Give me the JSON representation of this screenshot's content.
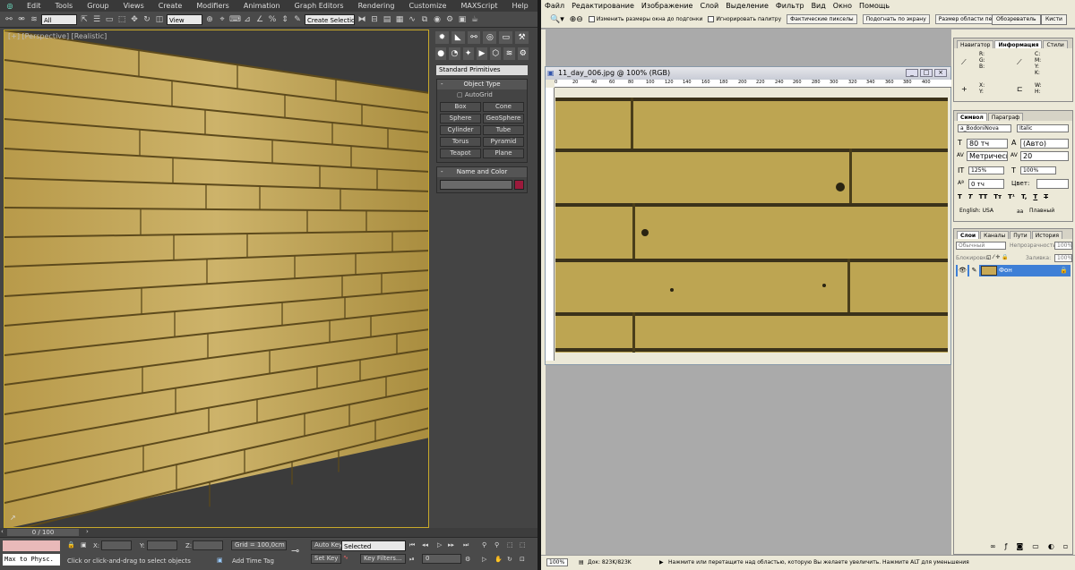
{
  "max": {
    "menu": [
      "Edit",
      "Tools",
      "Group",
      "Views",
      "Create",
      "Modifiers",
      "Animation",
      "Graph Editors",
      "Rendering",
      "Customize",
      "MAXScript",
      "Help"
    ],
    "toolbar": {
      "filter": "All",
      "ref_coord": "View",
      "selection_set": "Create Selection Se"
    },
    "viewport_label": "[+] [Perspective] [Realistic]",
    "command_panel": {
      "category": "Standard Primitives",
      "object_type_title": "Object Type",
      "autogrid": "AutoGrid",
      "primitives": [
        "Box",
        "Cone",
        "Sphere",
        "GeoSphere",
        "Cylinder",
        "Tube",
        "Torus",
        "Pyramid",
        "Teapot",
        "Plane"
      ],
      "name_color_title": "Name and Color",
      "object_color": "#9c1a3c"
    },
    "time_slider": "0 / 100",
    "status": {
      "listener_text": "Max to Physc.",
      "prompt": "Click or click-and-drag to select objects",
      "x_label": "X:",
      "y_label": "Y:",
      "z_label": "Z:",
      "grid": "Grid = 100,0cm",
      "add_time_tag": "Add Time Tag",
      "auto_key": "Auto Key",
      "set_key": "Set Key",
      "selected": "Selected",
      "key_filters": "Key Filters...",
      "frame": "0"
    }
  },
  "ps": {
    "menu": [
      "Файл",
      "Редактирование",
      "Изображение",
      "Слой",
      "Выделение",
      "Фильтр",
      "Вид",
      "Окно",
      "Помощь"
    ],
    "options": {
      "resize_windows": "Изменить размеры окна до подгонки",
      "ignore_palettes": "Игнорировать палитру",
      "actual_pixels": "Фактические пикселы",
      "fit_screen": "Подогнать по экрану",
      "print_size": "Размер области печати"
    },
    "workspace": {
      "browser": "Обозреватель",
      "brushes": "Кисти"
    },
    "document": {
      "title": "11_day_006.jpg @ 100% (RGB)",
      "ruler": [
        "0",
        "20",
        "40",
        "60",
        "80",
        "100",
        "120",
        "140",
        "160",
        "180",
        "200",
        "220",
        "240",
        "260",
        "280",
        "300",
        "320",
        "340",
        "360",
        "380",
        "400"
      ],
      "zoom": "100%",
      "doc_size": "Док: 823K/823K",
      "hint": "Нажмите или перетащите над областью, которую Вы желаете увеличить. Нажмите ALT для уменьшения"
    },
    "info_panel": {
      "tabs": [
        "Навигатор",
        "Информация",
        "Стили"
      ],
      "rgb": [
        "R:",
        "G:",
        "B:"
      ],
      "cmyk": [
        "C:",
        "M:",
        "Y:",
        "K:"
      ],
      "xy": [
        "X:",
        "Y:"
      ],
      "wh": [
        "W:",
        "H:"
      ]
    },
    "char_panel": {
      "tabs": [
        "Символ",
        "Параграф"
      ],
      "font": "a_BodoniNova",
      "style": "Italic",
      "size": "80 тч",
      "leading": "(Авто)",
      "kerning": "Метрическ",
      "tracking": "20",
      "vscale": "125%",
      "hscale": "100%",
      "baseline": "0 тч",
      "color_label": "Цвет:",
      "lang": "English: USA",
      "aa_label": "aa",
      "aa": "Плавный",
      "style_buttons": [
        "T",
        "T",
        "TT",
        "Tт",
        "T¹",
        "T,",
        "T",
        "T"
      ]
    },
    "layers_panel": {
      "tabs": [
        "Слои",
        "Каналы",
        "Пути",
        "История"
      ],
      "blend": "Обычный",
      "opacity_label": "Непрозрачность:",
      "opacity": "100%",
      "lock_label": "Блокировка:",
      "fill_label": "Заливка:",
      "fill": "100%",
      "layer_name": "Фон"
    }
  }
}
